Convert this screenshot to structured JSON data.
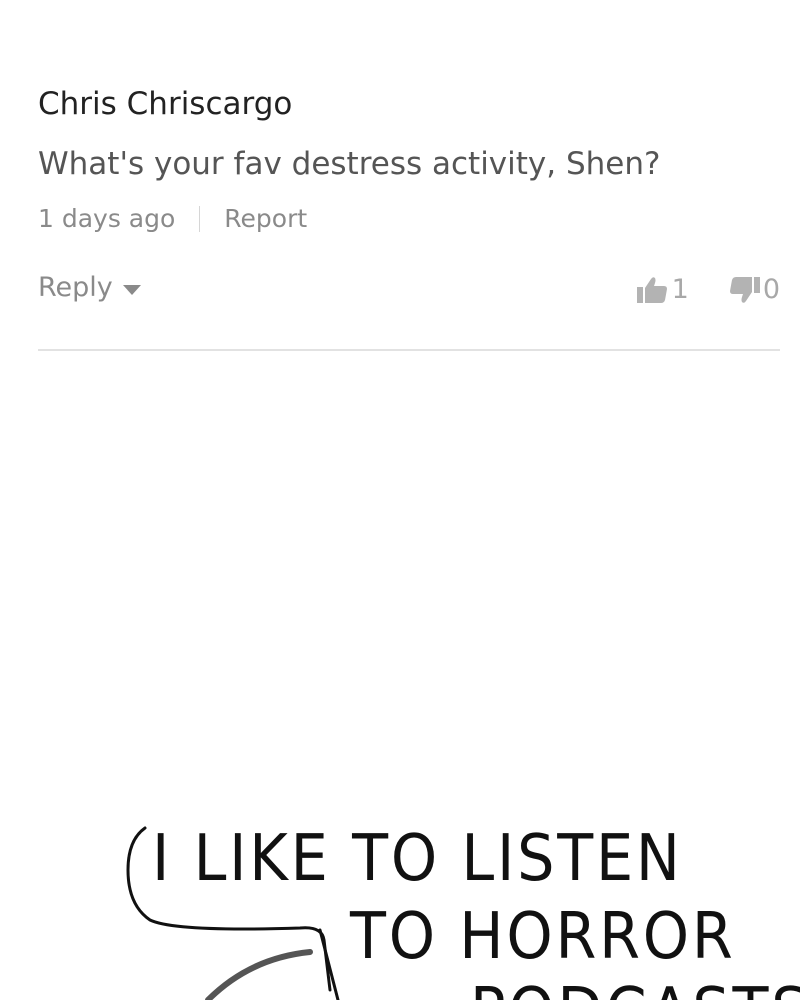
{
  "comment": {
    "author": "Chris Chriscargo",
    "text": "What's your fav destress activity, Shen?",
    "time": "1 days ago",
    "report_label": "Report",
    "reply_label": "Reply",
    "likes": "1",
    "dislikes": "0"
  },
  "comic": {
    "line1": "I LIKE TO LISTEN",
    "line2": "TO HORROR",
    "line3": "PODCASTS"
  },
  "icons": {
    "reply_menu": "caret-down-icon",
    "like": "thumbs-up-icon",
    "dislike": "thumbs-down-icon"
  },
  "colors": {
    "author": "#222222",
    "text": "#555555",
    "meta": "#8a8a8a",
    "votes": "#a8a8a8",
    "divider": "#e2e2e2"
  }
}
